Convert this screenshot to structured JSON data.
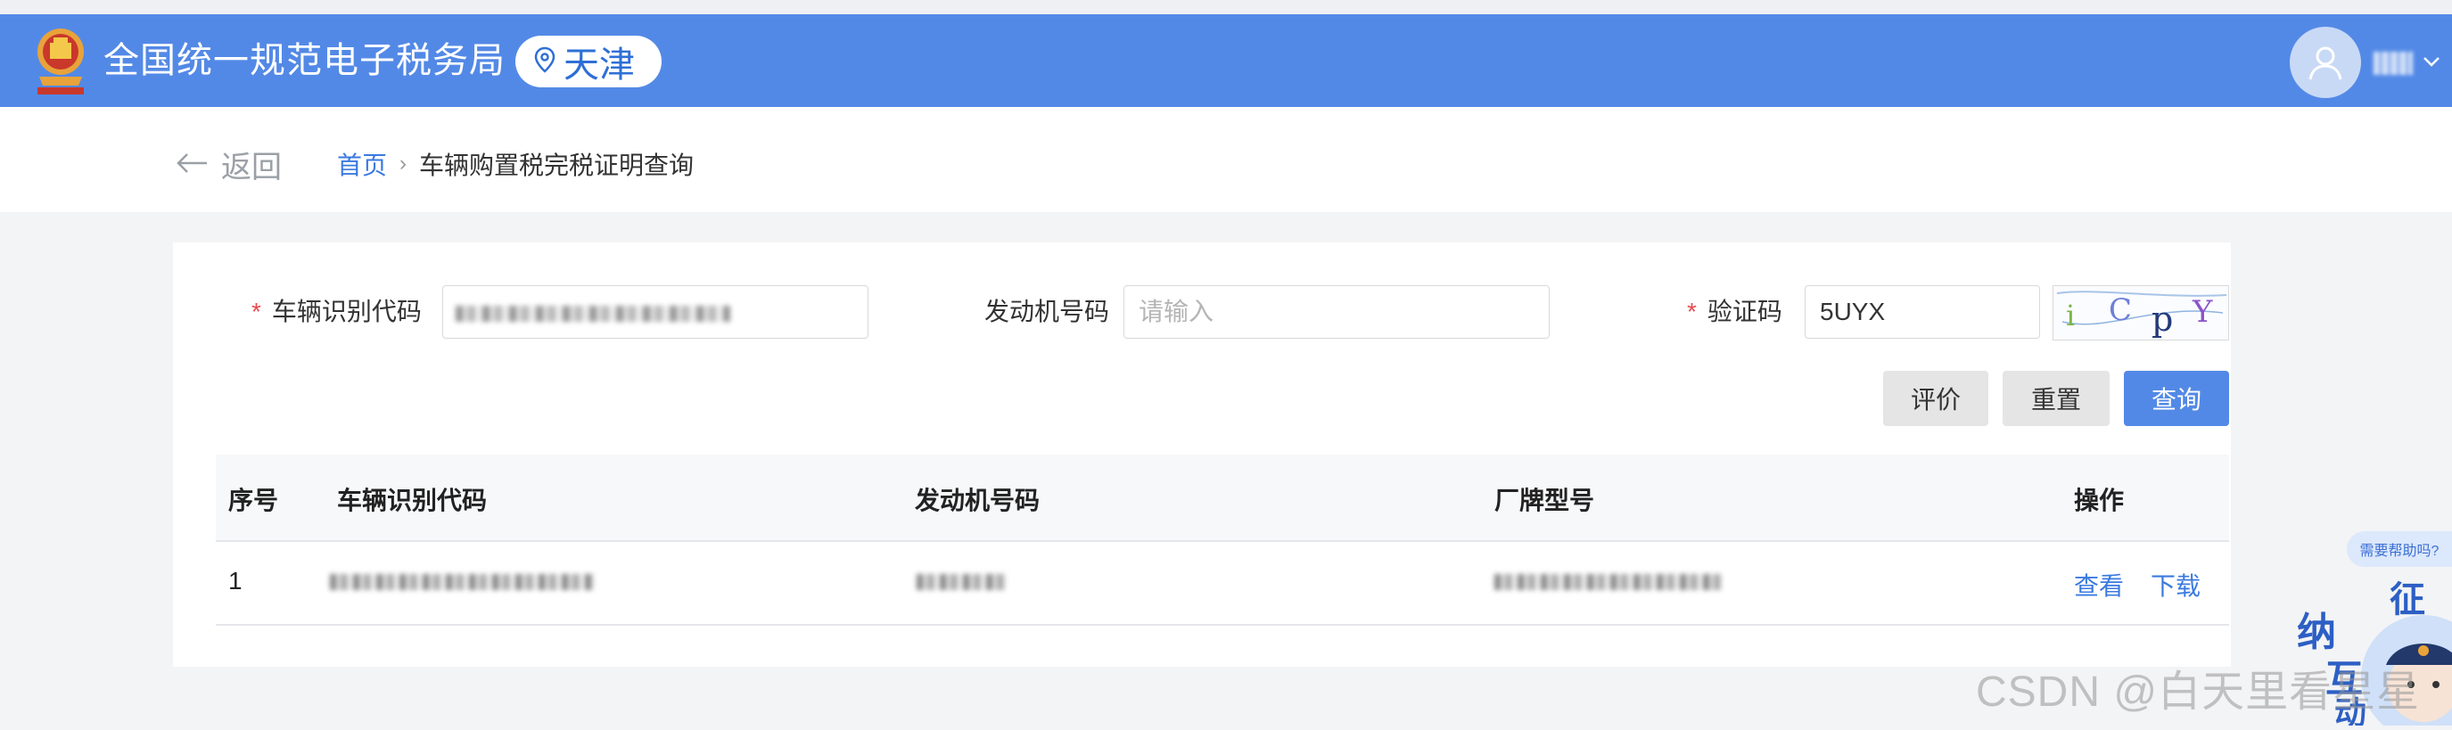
{
  "header": {
    "site_title": "全国统一规范电子税务局",
    "region": "天津"
  },
  "subnav": {
    "back_label": "返回",
    "breadcrumb_home": "首页",
    "breadcrumb_separator": "›",
    "breadcrumb_current": "车辆购置税完税证明查询"
  },
  "form": {
    "vin": {
      "label": "车辆识别代码",
      "required": true
    },
    "engine": {
      "label": "发动机号码",
      "placeholder": "请输入"
    },
    "captcha": {
      "label": "验证码",
      "required": true,
      "value": "5UYX",
      "image_chars": [
        "i",
        "C",
        "p",
        "Y"
      ]
    }
  },
  "buttons": {
    "evaluate": "评价",
    "reset": "重置",
    "query": "查询"
  },
  "table": {
    "columns": [
      "序号",
      "车辆识别代码",
      "发动机号码",
      "厂牌型号",
      "操作"
    ],
    "rows": [
      {
        "index": "1",
        "actions": [
          "查看",
          "下载"
        ]
      }
    ]
  },
  "widgets": {
    "help_label": "需要帮助吗?",
    "mascot_chars": [
      "征",
      "纳",
      "互",
      "动"
    ]
  },
  "watermark": "CSDN @白天里看星星",
  "colors": {
    "header": "#5389e6",
    "link": "#3b7ae0",
    "required": "#e5484d",
    "primary_button": "#5389e6"
  }
}
